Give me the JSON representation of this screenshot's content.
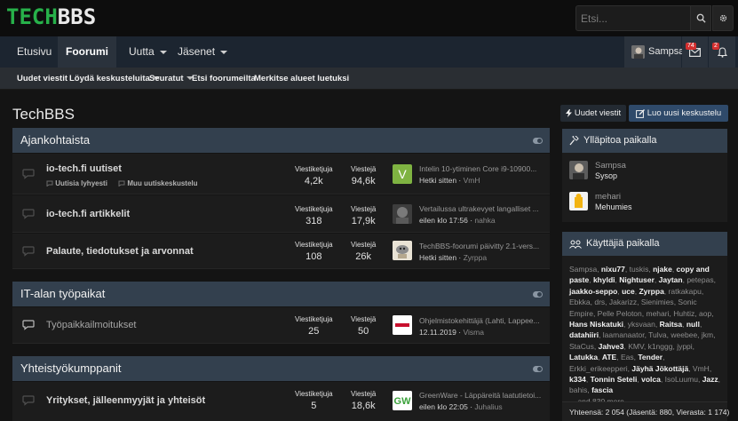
{
  "site": {
    "logo_a": "TECH",
    "logo_b": "BBS",
    "search_placeholder": "Etsi..."
  },
  "nav": {
    "items": [
      {
        "label": "Etusivu"
      },
      {
        "label": "Foorumi"
      },
      {
        "label": "Uutta"
      },
      {
        "label": "Jäsenet"
      }
    ],
    "user": "Sampsa",
    "inbox_badge": "74",
    "alerts_badge": "2"
  },
  "subnav": [
    "Uudet viestit",
    "Löydä keskusteluita",
    "Seuratut",
    "Etsi foorumeilta",
    "Merkitse alueet luetuksi"
  ],
  "page": {
    "title": "TechBBS",
    "btn_new": "Uudet viestit",
    "btn_create": "Luo uusi keskustelu"
  },
  "categories": [
    {
      "title": "Ajankohtaista",
      "forums": [
        {
          "title": "io-tech.fi uutiset",
          "subforums": [
            "Uutisia lyhyesti",
            "Muu uutiskeskustelu"
          ],
          "threads_label": "Viestiketjuja",
          "threads": "4,2k",
          "posts_label": "Viestejä",
          "posts": "94,6k",
          "last_title": "Intelin 10-ytiminen Core i9-10900...",
          "last_when": "Hetki sitten",
          "last_user": "VmH"
        },
        {
          "title": "io-tech.fi artikkelit",
          "subforums": [],
          "threads_label": "Viestiketjuja",
          "threads": "318",
          "posts_label": "Viestejä",
          "posts": "17,9k",
          "last_title": "Vertailussa ultrakevyet langalliset ...",
          "last_when": "eilen klo 17:56",
          "last_user": "nahka"
        },
        {
          "title": "Palaute, tiedotukset ja arvonnat",
          "subforums": [],
          "threads_label": "Viestiketjuja",
          "threads": "108",
          "posts_label": "Viestejä",
          "posts": "26k",
          "last_title": "TechBBS-foorumi päivitty 2.1-vers...",
          "last_when": "Hetki sitten",
          "last_user": "Zyrppa"
        }
      ]
    },
    {
      "title": "IT-alan työpaikat",
      "forums": [
        {
          "title": "Työpaikkailmoitukset",
          "subforums": [],
          "threads_label": "Viestiketjuja",
          "threads": "25",
          "posts_label": "Viestejä",
          "posts": "50",
          "last_title": "Ohjelmistokehittäjä (Lahti, Lappee...",
          "last_when": "12.11.2019",
          "last_user": "Visma"
        }
      ]
    },
    {
      "title": "Yhteistyökumppanit",
      "forums": [
        {
          "title": "Yritykset, jälleenmyyjät ja yhteisöt",
          "subforums": [],
          "threads_label": "Viestiketjuja",
          "threads": "5",
          "posts_label": "Viestejä",
          "posts": "18,6k",
          "last_title": "GreenWare - Läppäreitä laatutietoi...",
          "last_when": "eilen klo 22:05",
          "last_user": "Juhalius"
        }
      ]
    }
  ],
  "sidebar": {
    "staff_title": "Ylläpitoa paikalla",
    "staff": [
      {
        "name": "Sampsa",
        "role": "Sysop"
      },
      {
        "name": "mehari",
        "role": "Mehumies"
      }
    ],
    "online_title": "Käyttäjiä paikalla",
    "online_users": [
      {
        "n": "Sampsa",
        "b": false
      },
      {
        "n": "nixu77",
        "b": true
      },
      {
        "n": "tuskis",
        "b": false
      },
      {
        "n": "njake",
        "b": true
      },
      {
        "n": "copy and paste",
        "b": true
      },
      {
        "n": "khyldi",
        "b": true
      },
      {
        "n": "Nightuser",
        "b": true
      },
      {
        "n": "Jaytan",
        "b": true
      },
      {
        "n": "petepas",
        "b": false
      },
      {
        "n": "jaakko-seppo",
        "b": true
      },
      {
        "n": "uce",
        "b": true
      },
      {
        "n": "Zyrppa",
        "b": true
      },
      {
        "n": "ratkakapu",
        "b": false
      },
      {
        "n": "Ebkka",
        "b": false
      },
      {
        "n": "drs",
        "b": false
      },
      {
        "n": "Jakarizz",
        "b": false
      },
      {
        "n": "Sienimies",
        "b": false
      },
      {
        "n": "Sonic Empire",
        "b": false
      },
      {
        "n": "Pelle Peloton",
        "b": false
      },
      {
        "n": "mehari",
        "b": false
      },
      {
        "n": "Huhtiz",
        "b": false
      },
      {
        "n": "aop",
        "b": false
      },
      {
        "n": "Hans Niskatuki",
        "b": true
      },
      {
        "n": "yksvaan",
        "b": false
      },
      {
        "n": "Raitsa",
        "b": true
      },
      {
        "n": "null",
        "b": true
      },
      {
        "n": "datahiiri",
        "b": true
      },
      {
        "n": "laamanaator",
        "b": false
      },
      {
        "n": "Tulva",
        "b": false
      },
      {
        "n": "weebee",
        "b": false
      },
      {
        "n": "jkm",
        "b": false
      },
      {
        "n": "StaCus",
        "b": false
      },
      {
        "n": "Jahve3",
        "b": true
      },
      {
        "n": "KMV",
        "b": false
      },
      {
        "n": "k1nggg",
        "b": false
      },
      {
        "n": "jyppi",
        "b": false
      },
      {
        "n": "Latukka",
        "b": true
      },
      {
        "n": "ATE",
        "b": true
      },
      {
        "n": "Eas",
        "b": false
      },
      {
        "n": "Tender",
        "b": true
      },
      {
        "n": "Erkki_erikeepperi",
        "b": false
      },
      {
        "n": "Jäyhä Jökottäjä",
        "b": true
      },
      {
        "n": "VmH",
        "b": false
      },
      {
        "n": "k334",
        "b": true
      },
      {
        "n": "Tonnin Seteli",
        "b": true
      },
      {
        "n": "volca",
        "b": true
      },
      {
        "n": "IsoLuumu",
        "b": false
      },
      {
        "n": "Jazz",
        "b": true
      },
      {
        "n": "bahis",
        "b": false
      },
      {
        "n": "fascia",
        "b": true
      }
    ],
    "more_text": "... and 830 more.",
    "total": "Yhteensä: 2 054 (Jäsentä: 880, Vierasta: 1 174)"
  }
}
